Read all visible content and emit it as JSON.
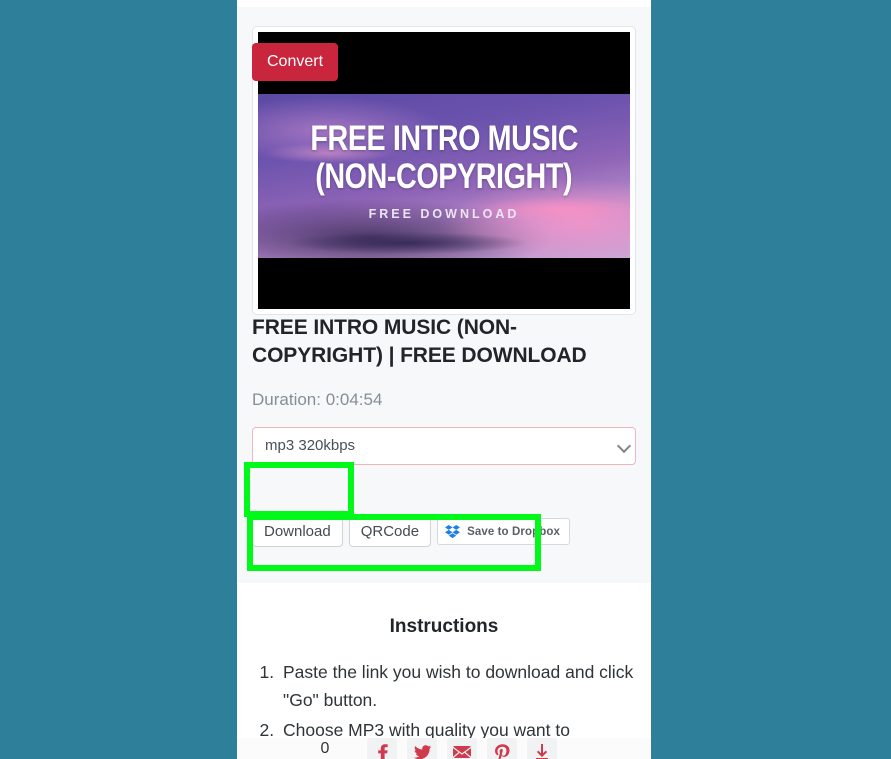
{
  "theme": {
    "page_background": "#2d7f9a",
    "panel_background": "#f7f8f9",
    "accent_red": "#c9253c",
    "highlight_green": "#00f919",
    "dropbox_blue": "#0061fe",
    "select_border": "#edb6bb",
    "share_icon_red": "#cf3a4c"
  },
  "thumbnail": {
    "line1": "FREE INTRO MUSIC",
    "line2": "(NON-COPYRIGHT)",
    "subtitle": "FREE DOWNLOAD",
    "icon_name": "video-thumbnail"
  },
  "video": {
    "title": "FREE INTRO MUSIC (NON-COPYRIGHT) | FREE DOWNLOAD",
    "duration": "Duration: 0:04:54"
  },
  "format": {
    "selected": "mp3 320kbps",
    "options": [
      "mp3 320kbps"
    ],
    "chevron_icon": "chevron-down-icon"
  },
  "convert": {
    "label": "Convert"
  },
  "actions": {
    "download_label": "Download",
    "qrcode_label": "QRCode",
    "dropbox_label": "Save to Dropbox",
    "dropbox_icon": "dropbox-icon"
  },
  "instructions": {
    "title": "Instructions",
    "steps": [
      "Paste the link you wish to download and click \"Go\" button.",
      "Choose MP3 with quality you want to"
    ]
  },
  "share": {
    "count": "0",
    "icons": [
      "facebook-icon",
      "twitter-icon",
      "email-icon",
      "pinterest-icon",
      "more-share-icon"
    ]
  }
}
